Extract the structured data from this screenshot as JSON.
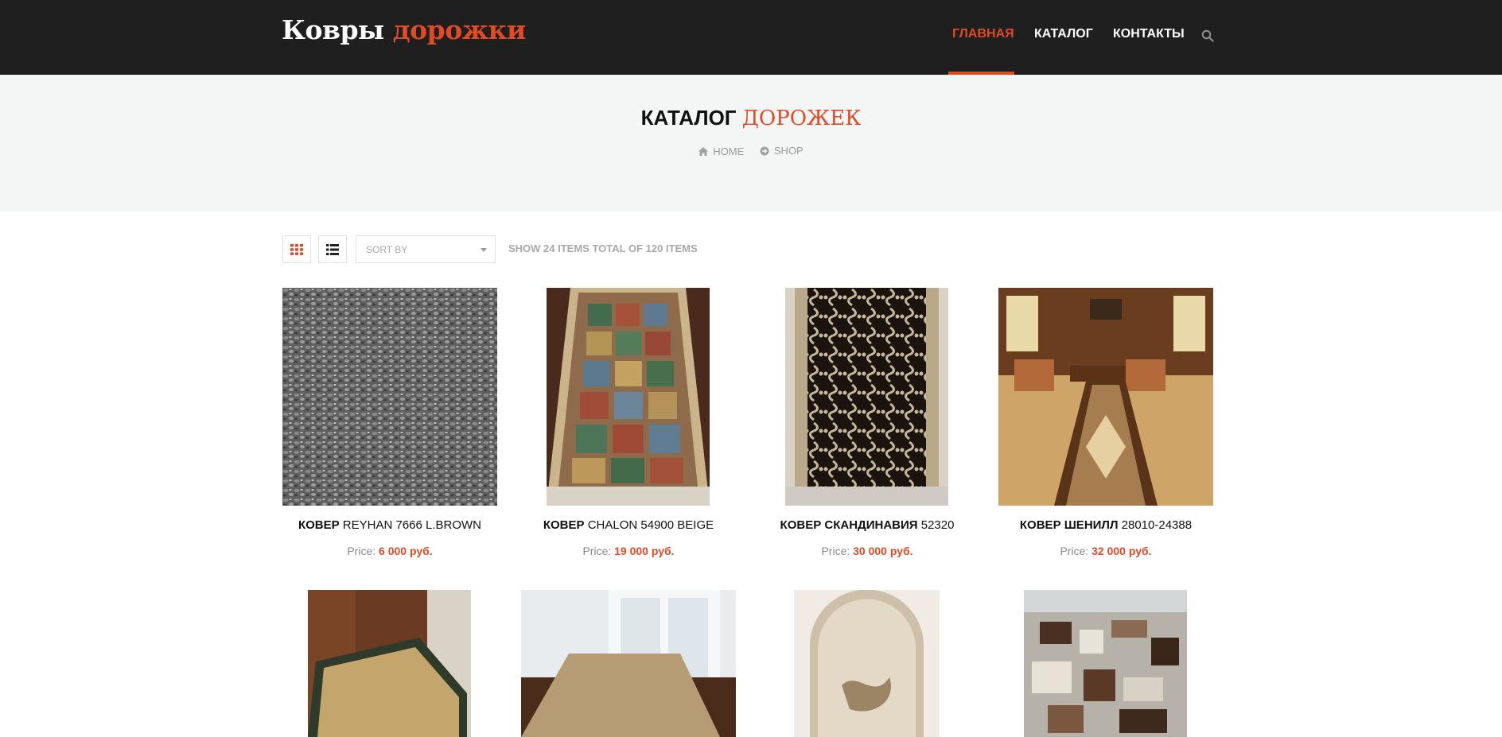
{
  "header": {
    "logo_main": "Ковры",
    "logo_accent": "дорожки",
    "nav": [
      {
        "label": "ГЛАВНАЯ"
      },
      {
        "label": "КАТАЛОГ"
      },
      {
        "label": "КОНТАКТЫ"
      }
    ],
    "accent_color": "#e04a24",
    "search_icon": "search-icon"
  },
  "banner": {
    "title_main": "КАТАЛОГ",
    "title_accent": "ДОРОЖЕК",
    "breadcrumbs": [
      {
        "label": "HOME",
        "icon": "home-icon"
      },
      {
        "label": "SHOP",
        "icon": "circle-arrow-icon"
      }
    ]
  },
  "toolbar": {
    "sort_label": "SORT BY",
    "show_text": "SHOW 24 ITEMS TOTAL OF 120 ITEMS"
  },
  "products": [
    {
      "type_label": "КОВЕР",
      "name": "REYHAN 7666 L.BROWN",
      "price_label": "Price:",
      "price": "6 000 руб."
    },
    {
      "type_label": "КОВЕР",
      "name": "CHALON 54900 BEIGE",
      "price_label": "Price:",
      "price": "19 000 руб."
    },
    {
      "type_label": "КОВЕР СКАНДИНАВИЯ",
      "name": "52320",
      "price_label": "Price:",
      "price": "30 000 руб."
    },
    {
      "type_label": "КОВЕР ШЕНИЛЛ",
      "name": "28010-24388",
      "price_label": "Price:",
      "price": "32 000 руб."
    }
  ]
}
